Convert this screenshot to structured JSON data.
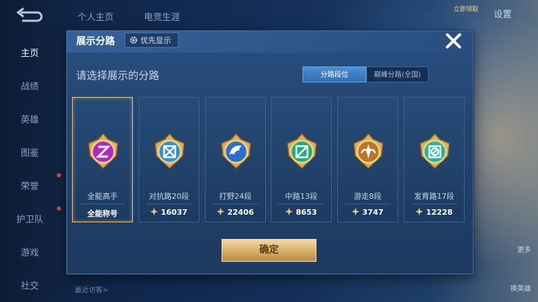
{
  "colors": {
    "accent_gold": "#e8c27a",
    "panel_blue": "#23446f",
    "tab_active": "#2f6fb3"
  },
  "topbar": {
    "tab_profile": "个人主页",
    "tab_esports": "电竞生涯",
    "settings_label": "设置",
    "badge_text": "立即领取"
  },
  "sidebar": {
    "back_icon": "back-arrow-icon",
    "items": [
      {
        "label": "主页",
        "active": true
      },
      {
        "label": "战绩"
      },
      {
        "label": "英雄"
      },
      {
        "label": "图鉴"
      },
      {
        "label": "荣誉",
        "dot": true
      },
      {
        "label": "护卫队",
        "dot": true
      },
      {
        "label": "游戏"
      },
      {
        "label": "社交"
      }
    ]
  },
  "bottom": {
    "visitors_label": "最近访客>",
    "right_btn_1": "更多",
    "right_btn_2": "换英雄"
  },
  "modal": {
    "title": "展示分路",
    "priority_label": "优先显示",
    "priority_icon": "gear-icon",
    "close_icon": "close-icon",
    "subtitle": "请选择展示的分路",
    "tabs": [
      {
        "label": "分路段位",
        "active": true
      },
      {
        "label": "巅峰分路(全国)",
        "active": false
      }
    ],
    "cards": [
      {
        "name": "全能高手",
        "score": "全能称号",
        "icon": "all-round-emblem-icon",
        "selected": true
      },
      {
        "name": "对抗路20段",
        "score": "16037",
        "icon": "clash-lane-emblem-icon"
      },
      {
        "name": "打野24段",
        "score": "22406",
        "icon": "jungle-emblem-icon"
      },
      {
        "name": "中路13段",
        "score": "8653",
        "icon": "mid-lane-emblem-icon"
      },
      {
        "name": "游走8段",
        "score": "3747",
        "icon": "roam-emblem-icon"
      },
      {
        "name": "发育路17段",
        "score": "12228",
        "icon": "farm-lane-emblem-icon"
      }
    ],
    "confirm_label": "确定"
  }
}
